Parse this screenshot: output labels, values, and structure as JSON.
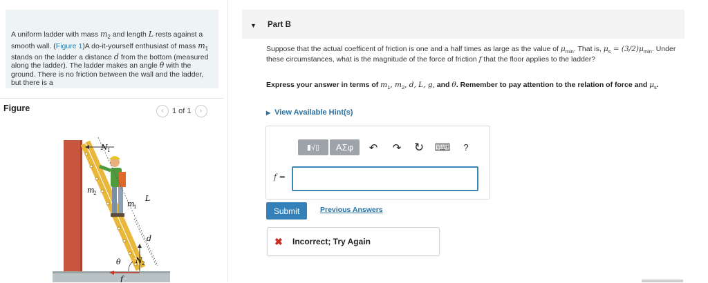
{
  "problem": {
    "text_1": "A uniform ladder with mass ",
    "m2": "m",
    "m2_sub": "2",
    "text_2": " and length ",
    "L": "L",
    "text_3": " rests against a smooth wall. (",
    "figure_link": "Figure 1",
    "text_4": ")A do-it-yourself enthusiast of mass ",
    "m1": "m",
    "m1_sub": "1",
    "text_5": " stands on the ladder a distance ",
    "d": "d",
    "text_6": " from the bottom (measured along the ladder). The ladder makes an angle ",
    "theta": "θ",
    "text_7": " with the ground. There is no friction between the wall and the ladder, but there is a"
  },
  "figure": {
    "header": "Figure",
    "pager": "1 of 1",
    "prev_icon": "‹",
    "next_icon": "›",
    "labels": {
      "N1": "N",
      "N1_sub": "1",
      "N2": "N",
      "N2_sub": "2",
      "m2": "m",
      "m2_sub": "2",
      "m1": "m",
      "m1_sub": "1",
      "L": "L",
      "d": "d",
      "theta": "θ",
      "f": "f"
    }
  },
  "part": {
    "arrow": "▼",
    "title": "Part B"
  },
  "question": {
    "t1": "Suppose that the actual coefficent of friction is one and a half times as large as the value of ",
    "mu_min": "μ",
    "mu_min_sub": "min",
    "t2": ". That is, ",
    "eq": "μ",
    "eq_sub": "s",
    "eq_rest": " = (3/2)μ",
    "eq_rest_sub": "min",
    "t3": ". Under these circumstances, what is the magnitude of the force of friction ",
    "f": "f",
    "t4": " that the floor applies to the ladder?"
  },
  "instruction": {
    "t1": "Express your answer in terms of ",
    "vars": "m",
    "s1": "1",
    "c1": ", m",
    "s2": "2",
    "c2": ", d, L, g,",
    "t2": " and ",
    "theta": "θ",
    "t3": ". Remember to pay attention to the relation of force and ",
    "mu": "μ",
    "mu_sub": "s",
    "t4": "."
  },
  "hint": {
    "arrow": "▶",
    "label": "View Available Hint(s)"
  },
  "toolbar": {
    "templates_label": "▮√▯",
    "greek_label": "ΑΣφ",
    "undo_icon": "↶",
    "redo_icon": "↷",
    "reset_icon": "↻",
    "keyboard_icon": "⌨",
    "help_label": "?"
  },
  "answer": {
    "label_f": "f",
    "label_eq": " =",
    "value": ""
  },
  "actions": {
    "submit": "Submit",
    "previous_answers": "Previous Answers"
  },
  "feedback": {
    "icon": "✖",
    "message": "Incorrect; Try Again"
  }
}
